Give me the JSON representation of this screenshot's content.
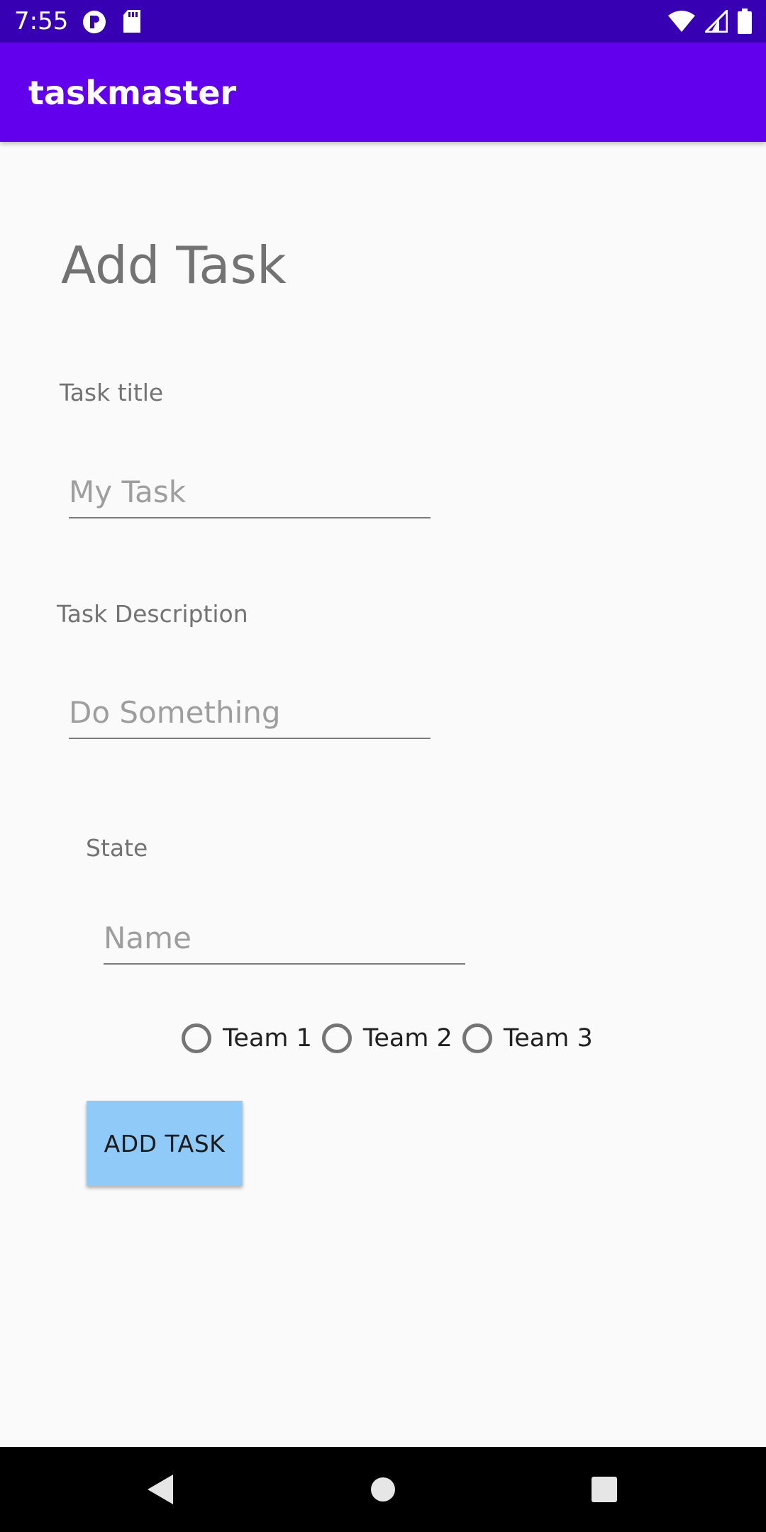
{
  "status_bar": {
    "time": "7:55",
    "left_icons": [
      "app-notification-icon",
      "sd-card-icon"
    ],
    "right_icons": [
      "wifi-icon",
      "cell-signal-icon",
      "battery-icon"
    ],
    "background": "#3700b3"
  },
  "app_bar": {
    "title": "taskmaster",
    "background": "#6200ee"
  },
  "form": {
    "heading": "Add Task",
    "title_label": "Task title",
    "title_placeholder": "My Task",
    "title_value": "",
    "description_label": "Task Description",
    "description_placeholder": "Do Something",
    "description_value": "",
    "state_label": "State",
    "state_placeholder": "Name",
    "state_value": "",
    "teams": [
      {
        "label": "Team 1",
        "selected": false
      },
      {
        "label": "Team 2",
        "selected": false
      },
      {
        "label": "Team 3",
        "selected": false
      }
    ],
    "submit_label": "ADD TASK",
    "submit_color": "#90caf9"
  },
  "nav_bar": {
    "buttons": [
      "back-icon",
      "home-icon",
      "recents-icon"
    ]
  }
}
